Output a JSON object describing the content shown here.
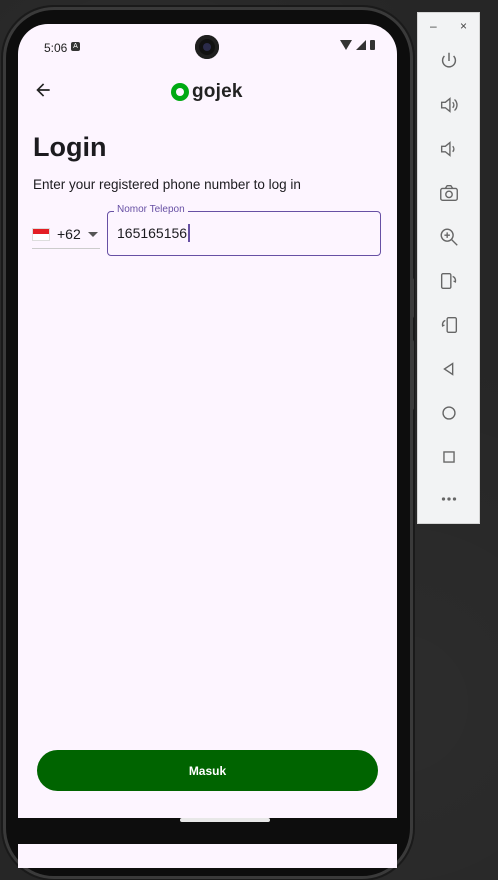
{
  "status_bar": {
    "time": "5:06",
    "notification_icon": "A"
  },
  "app_bar": {
    "back_icon": "arrow-left-icon",
    "logo_text": "gojek",
    "logo_color": "#00aa13"
  },
  "login": {
    "title": "Login",
    "subtitle": "Enter your registered phone number to log in",
    "country": {
      "flag": "indonesia-flag",
      "dial_code": "+62"
    },
    "phone_field": {
      "label": "Nomor Telepon",
      "value": "165165156"
    },
    "submit_label": "Masuk",
    "submit_color": "#006400",
    "accent_color": "#6750a4"
  },
  "emulator_panel": {
    "minimize": "–",
    "close": "×",
    "buttons": [
      "power-icon",
      "volume-up-icon",
      "volume-down-icon",
      "camera-icon",
      "zoom-icon",
      "rotate-left-icon",
      "rotate-right-icon",
      "back-triangle-icon",
      "home-circle-icon",
      "overview-square-icon",
      "more-icon"
    ]
  }
}
